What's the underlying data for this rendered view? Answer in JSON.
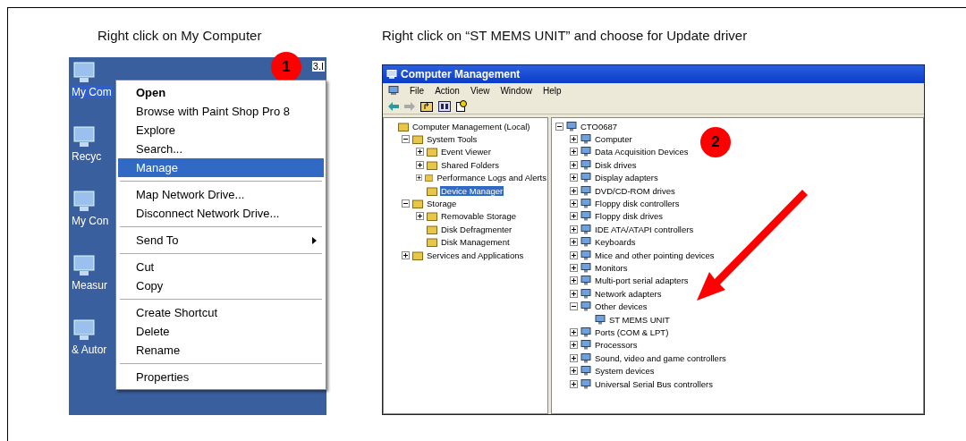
{
  "captions": [
    "Right click on My Computer",
    "Right click on “ST MEMS UNIT” and choose for Update driver"
  ],
  "desktop": {
    "corner_text": "3.I",
    "badge": "1",
    "icons": [
      {
        "label": "My Com",
        "selected": true
      },
      {
        "label": "Recyc",
        "selected": false
      },
      {
        "label": "My Con",
        "selected": false
      },
      {
        "label": "Measur",
        "selected": false
      },
      {
        "label": "& Autor",
        "selected": false
      }
    ]
  },
  "context_menu": {
    "groups": [
      [
        {
          "label": "Open",
          "bold": true,
          "selected": false
        },
        {
          "label": "Browse with Paint Shop Pro 8",
          "selected": false
        },
        {
          "label": "Explore",
          "selected": false
        },
        {
          "label": "Search...",
          "selected": false
        },
        {
          "label": "Manage",
          "selected": true
        }
      ],
      [
        {
          "label": "Map Network Drive...",
          "selected": false
        },
        {
          "label": "Disconnect Network Drive...",
          "selected": false
        }
      ],
      [
        {
          "label": "Send To",
          "submenu": true,
          "selected": false
        }
      ],
      [
        {
          "label": "Cut",
          "selected": false
        },
        {
          "label": "Copy",
          "selected": false
        }
      ],
      [
        {
          "label": "Create Shortcut",
          "selected": false
        },
        {
          "label": "Delete",
          "selected": false
        },
        {
          "label": "Rename",
          "selected": false
        }
      ],
      [
        {
          "label": "Properties",
          "selected": false
        }
      ]
    ]
  },
  "window": {
    "title": "Computer Management",
    "menu": [
      "File",
      "Action",
      "View",
      "Window",
      "Help"
    ],
    "badge": "2",
    "left_tree": [
      {
        "label": "Computer Management (Local)",
        "selected": false,
        "children": [
          {
            "label": "System Tools",
            "expanded": true,
            "selected": false,
            "children": [
              {
                "label": "Event Viewer",
                "expanded": false,
                "selected": false
              },
              {
                "label": "Shared Folders",
                "expanded": false,
                "selected": false
              },
              {
                "label": "Performance Logs and Alerts",
                "expanded": false,
                "selected": false
              },
              {
                "label": "Device Manager",
                "selected": true
              }
            ]
          },
          {
            "label": "Storage",
            "expanded": true,
            "selected": false,
            "children": [
              {
                "label": "Removable Storage",
                "expanded": false,
                "selected": false
              },
              {
                "label": "Disk Defragmenter",
                "selected": false
              },
              {
                "label": "Disk Management",
                "selected": false
              }
            ]
          },
          {
            "label": "Services and Applications",
            "expanded": false,
            "selected": false
          }
        ]
      }
    ],
    "right_tree": [
      {
        "label": "CTO0687",
        "expanded": true,
        "selected": false,
        "children": [
          {
            "label": "Computer",
            "expanded": false,
            "selected": false
          },
          {
            "label": "Data Acquisition Devices",
            "expanded": false,
            "selected": false
          },
          {
            "label": "Disk drives",
            "expanded": false,
            "selected": false
          },
          {
            "label": "Display adapters",
            "expanded": false,
            "selected": false
          },
          {
            "label": "DVD/CD-ROM drives",
            "expanded": false,
            "selected": false
          },
          {
            "label": "Floppy disk controllers",
            "expanded": false,
            "selected": false
          },
          {
            "label": "Floppy disk drives",
            "expanded": false,
            "selected": false
          },
          {
            "label": "IDE ATA/ATAPI controllers",
            "expanded": false,
            "selected": false
          },
          {
            "label": "Keyboards",
            "expanded": false,
            "selected": false
          },
          {
            "label": "Mice and other pointing devices",
            "expanded": false,
            "selected": false
          },
          {
            "label": "Monitors",
            "expanded": false,
            "selected": false
          },
          {
            "label": "Multi-port serial adapters",
            "expanded": false,
            "selected": false
          },
          {
            "label": "Network adapters",
            "expanded": false,
            "selected": false
          },
          {
            "label": "Other devices",
            "expanded": true,
            "selected": false,
            "children": [
              {
                "label": "ST MEMS UNIT",
                "selected": false
              }
            ]
          },
          {
            "label": "Ports (COM & LPT)",
            "expanded": false,
            "selected": false
          },
          {
            "label": "Processors",
            "expanded": false,
            "selected": false
          },
          {
            "label": "Sound, video and game controllers",
            "expanded": false,
            "selected": false
          },
          {
            "label": "System devices",
            "expanded": false,
            "selected": false
          },
          {
            "label": "Universal Serial Bus controllers",
            "expanded": false,
            "selected": false
          }
        ]
      }
    ]
  }
}
